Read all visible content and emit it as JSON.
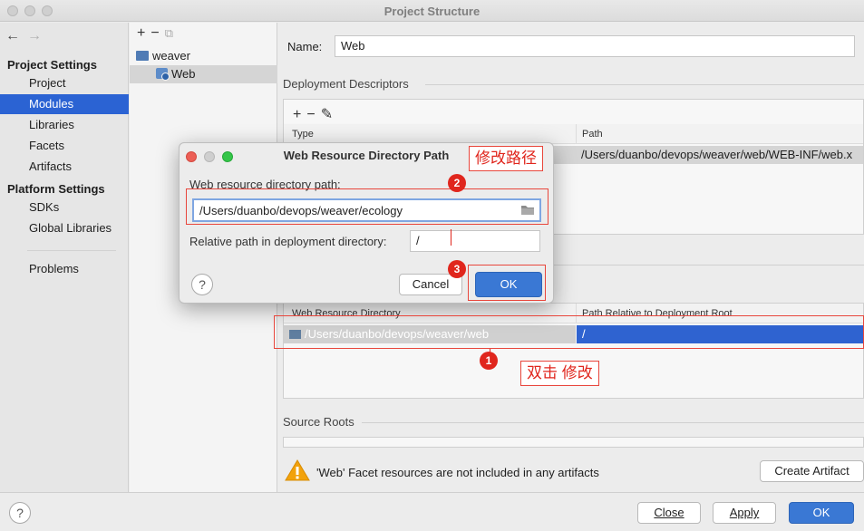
{
  "window": {
    "title": "Project Structure"
  },
  "nav": {
    "back": "←",
    "forward": "→"
  },
  "sidebar": {
    "project_settings_heading": "Project Settings",
    "project_settings": [
      {
        "label": "Project"
      },
      {
        "label": "Modules",
        "selected": true
      },
      {
        "label": "Libraries"
      },
      {
        "label": "Facets"
      },
      {
        "label": "Artifacts"
      }
    ],
    "platform_settings_heading": "Platform Settings",
    "platform_settings": [
      {
        "label": "SDKs"
      },
      {
        "label": "Global Libraries"
      }
    ],
    "problems": "Problems"
  },
  "tree": {
    "toolbar": {
      "add": "+",
      "remove": "−",
      "copy": "⧉"
    },
    "nodes": [
      {
        "label": "weaver",
        "icon": "folder-module-icon"
      },
      {
        "label": "Web",
        "icon": "web-facet-icon",
        "selected": true
      }
    ]
  },
  "main": {
    "name_label": "Name:",
    "name_value": "Web",
    "deployment_descriptors": {
      "heading": "Deployment Descriptors",
      "toolbar": {
        "add": "+",
        "remove": "−",
        "edit": "✎"
      },
      "columns": [
        "Type",
        "Path"
      ],
      "rows": [
        {
          "type": "",
          "path": "/Users/duanbo/devops/weaver/web/WEB-INF/web.x"
        }
      ]
    },
    "web_resource": {
      "columns": [
        "Web Resource Directory",
        "Path Relative to Deployment Root"
      ],
      "rows": [
        {
          "directory": "/Users/duanbo/devops/weaver/web",
          "relative": "/"
        }
      ]
    },
    "source_roots": {
      "heading": "Source Roots"
    },
    "warning": {
      "text": "'Web' Facet resources are not included in any artifacts",
      "button": "Create Artifact"
    }
  },
  "footer": {
    "help": "?",
    "close": "Close",
    "apply": "Apply",
    "ok": "OK"
  },
  "dialog": {
    "title": "Web Resource Directory Path",
    "path_label": "Web resource directory path:",
    "path_value": "/Users/duanbo/devops/weaver/ecology",
    "relative_label": "Relative path in deployment directory:",
    "relative_value": "/",
    "help": "?",
    "cancel": "Cancel",
    "ok": "OK"
  },
  "annotations": {
    "badge1": "1",
    "badge2": "2",
    "badge3": "3",
    "note1": "双击 修改",
    "note2": "修改路径"
  },
  "colors": {
    "selection": "#2b63d3",
    "primary_button": "#3a78d4",
    "annotation_red": "#e0261d",
    "warning_yellow": "#f2a20c"
  }
}
